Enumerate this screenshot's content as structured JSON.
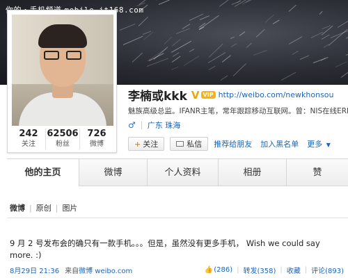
{
  "watermark": {
    "text": "你的・手机频道",
    "url": "mobile.it168.com"
  },
  "profile": {
    "name": "李楠或kkk",
    "verify_mark": "V",
    "vip_badge": "VIP",
    "url": "http://weibo.com/newkhonsou",
    "bio": "魅族高级总监。IFANR主笔，常年跟踪移动互联网。曾：NIS在线ERP系统",
    "gender_symbol": "♂",
    "location": "广东 珠海"
  },
  "stats": [
    {
      "value": "242",
      "label": "关注"
    },
    {
      "value": "62506",
      "label": "粉丝"
    },
    {
      "value": "726",
      "label": "微博"
    }
  ],
  "actions": {
    "follow": "关注",
    "message": "私信",
    "recommend": "推荐给朋友",
    "blacklist": "加入黑名单",
    "more": "更多"
  },
  "tabs": [
    {
      "label": "他的主页",
      "active": true
    },
    {
      "label": "微博",
      "active": false
    },
    {
      "label": "个人资料",
      "active": false
    },
    {
      "label": "相册",
      "active": false
    },
    {
      "label": "赞",
      "active": false
    }
  ],
  "filters": [
    {
      "label": "微博",
      "active": true
    },
    {
      "label": "原创",
      "active": false
    },
    {
      "label": "图片",
      "active": false
    }
  ],
  "post": {
    "text": "9 月 2 号发布会的确只有一款手机。。。但是，虽然没有更多手机， Wish we could say more. :)",
    "time": "8月29日 21:36",
    "source_label": "来自",
    "source": "微博 weibo.com",
    "likes": "(286)",
    "repost": "转发(358)",
    "favorite": "收藏",
    "comment": "评论(893)"
  }
}
